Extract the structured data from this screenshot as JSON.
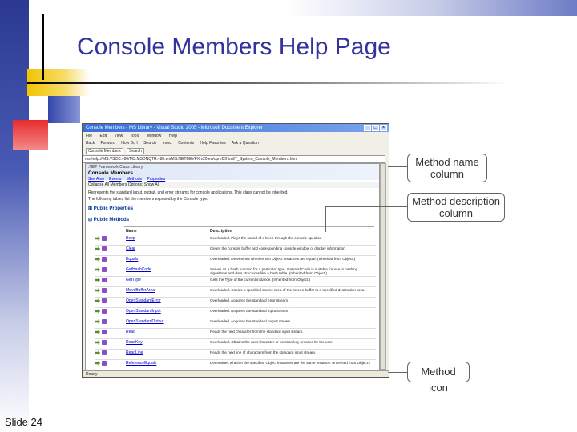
{
  "slide": {
    "title": "Console Members Help Page",
    "number": "Slide 24"
  },
  "window": {
    "title": "Console Members - MS Library - Visual Studio 2005 - Microsoft Document Explorer",
    "menu": [
      "File",
      "Edit",
      "View",
      "Tools",
      "Window",
      "Help"
    ],
    "toolbar": [
      "Back",
      "Forward",
      "How Do I",
      "Search",
      "Index",
      "Contents",
      "Help Favorites",
      "Ask a Question"
    ],
    "tabs": [
      "Console Members",
      "Search"
    ],
    "url": "ms-help://MS.VSCC.v80/MS.MSDNQTR.v80.en/MS.NETDEVFX.v20.en/cpref2/html/T_System_Console_Members.htm",
    "status": "Ready"
  },
  "page": {
    "library": ".NET Framework Class Library",
    "heading": "Console Members",
    "links": [
      "See Also",
      "Events",
      "Methods",
      "Properties"
    ],
    "filter": "Collapse All    Members Options: Show All",
    "summary": "Represents the standard input, output, and error streams for console applications. This class cannot be inherited.",
    "summary2": "The following tables list the members exposed by the Console type.",
    "section_properties": "Public Properties",
    "section_methods": "Public Methods",
    "col_name": "Name",
    "col_description": "Description",
    "methods": [
      {
        "name": "Beep",
        "desc": "Overloaded. Plays the sound of a beep through the console speaker."
      },
      {
        "name": "Clear",
        "desc": "Clears the console buffer and corresponding console window of display information."
      },
      {
        "name": "Equals",
        "desc": "Overloaded. Determines whether two Object instances are equal. (Inherited from Object.)"
      },
      {
        "name": "GetHashCode",
        "desc": "Serves as a hash function for a particular type. GetHashCode is suitable for use in hashing algorithms and data structures like a hash table. (Inherited from Object.)"
      },
      {
        "name": "GetType",
        "desc": "Gets the Type of the current instance. (Inherited from Object.)"
      },
      {
        "name": "MoveBufferArea",
        "desc": "Overloaded. Copies a specified source area of the screen buffer to a specified destination area."
      },
      {
        "name": "OpenStandardError",
        "desc": "Overloaded. Acquires the standard error stream."
      },
      {
        "name": "OpenStandardInput",
        "desc": "Overloaded. Acquires the standard input stream."
      },
      {
        "name": "OpenStandardOutput",
        "desc": "Overloaded. Acquires the standard output stream."
      },
      {
        "name": "Read",
        "desc": "Reads the next character from the standard input stream."
      },
      {
        "name": "ReadKey",
        "desc": "Overloaded. Obtains the next character or function key pressed by the user."
      },
      {
        "name": "ReadLine",
        "desc": "Reads the next line of characters from the standard input stream."
      },
      {
        "name": "ReferenceEquals",
        "desc": "Determines whether the specified Object instances are the same instance. (Inherited from Object.)"
      }
    ]
  },
  "callouts": {
    "name_col": "Method name column",
    "desc_col": "Method description column",
    "icon": "Method icon"
  },
  "colors": {
    "title": "#333399",
    "link": "#0000cc",
    "section": "#003399"
  }
}
